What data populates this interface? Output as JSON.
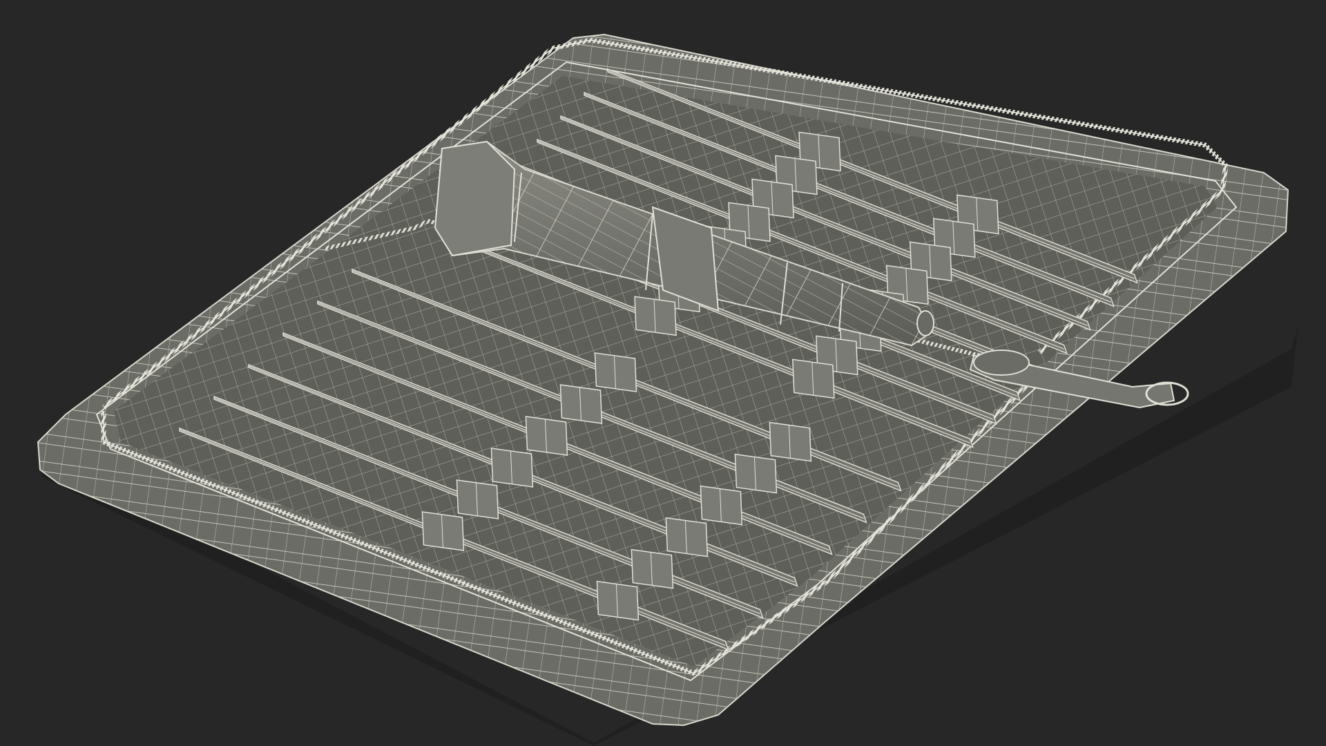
{
  "scene": {
    "subject": "wireframe-precision-screwdriver-kit-in-zippered-case",
    "colors": {
      "background": "#272727",
      "surface": "#6f6f6a",
      "surface_dark": "#5e5e59",
      "surface_light": "#86867f",
      "wire": "#d6d6cc",
      "wire_dim": "#b4b4aa",
      "shadow": "#1c1c1c"
    }
  },
  "kit": {
    "upper_row_tool_count": 8,
    "lower_row_tool_count": 6,
    "has_handle": true,
    "has_zipper_pull": true
  }
}
